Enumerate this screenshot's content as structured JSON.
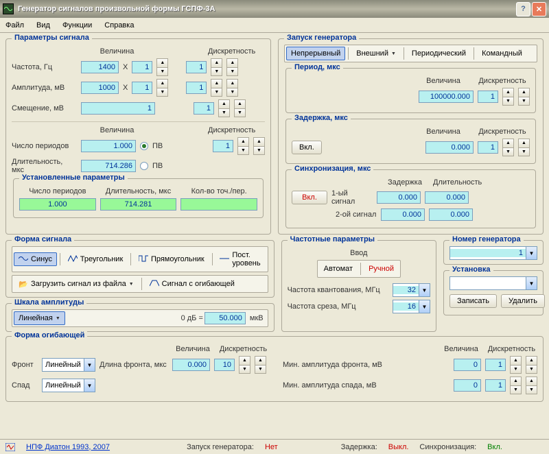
{
  "title": "Генератор сигналов произвольной формы ГСПФ-3А",
  "menu": [
    "Файл",
    "Вид",
    "Функции",
    "Справка"
  ],
  "sigparams": {
    "legend": "Параметры сигнала",
    "col_val": "Величина",
    "col_disc": "Дискретность",
    "freq_lbl": "Частота, Гц",
    "freq_val": "1400",
    "freq_mul": "1",
    "freq_disc": "1",
    "amp_lbl": "Амплитуда, мВ",
    "amp_val": "1000",
    "amp_mul": "1",
    "amp_disc": "1",
    "off_lbl": "Смещение, мВ",
    "off_val": "1",
    "off_disc": "1",
    "periods_lbl": "Число периодов",
    "periods_val": "1.000",
    "periods_disc": "1",
    "dur_lbl": "Длительность, мкс",
    "dur_val": "714.286",
    "radio_pv": "ПВ",
    "set_legend": "Установленные параметры",
    "set_periods_lbl": "Число периодов",
    "set_periods_val": "1.000",
    "set_dur_lbl": "Длительность, мкс",
    "set_dur_val": "714.281",
    "set_pts_lbl": "Кол-во точ./пер."
  },
  "gen": {
    "legend": "Запуск генератора",
    "modes": [
      "Непрерывный",
      "Внешний",
      "Периодический",
      "Командный"
    ],
    "period_legend": "Период, мкс",
    "col_val": "Величина",
    "col_disc": "Дискретность",
    "period_val": "100000.000",
    "period_disc": "1",
    "delay_legend": "Задержка, мкс",
    "delay_btn": "Вкл.",
    "delay_val": "0.000",
    "delay_disc": "1",
    "sync_legend": "Синхронизация, мкс",
    "sync_btn": "Вкл.",
    "sync_delay_lbl": "Задержка",
    "sync_dur_lbl": "Длительность",
    "sync_sig1_lbl": "1-ый сигнал",
    "sync_sig1_delay": "0.000",
    "sync_sig1_dur": "0.000",
    "sync_sig2_lbl": "2-ой сигнал",
    "sync_sig2_delay": "0.000",
    "sync_sig2_dur": "0.000"
  },
  "shape": {
    "legend": "Форма сигнала",
    "sinus": "Синус",
    "tri": "Треугольник",
    "rect": "Прямоугольник",
    "dc": "Пост. уровень",
    "load": "Загрузить сигнал  из файла",
    "envelope": "Сигнал с огибающей"
  },
  "scale": {
    "legend": "Шкала амплитуды",
    "mode": "Линейная",
    "zero_db": "0 дБ =",
    "val": "50.000",
    "unit": "мкВ"
  },
  "freqp": {
    "legend": "Частотные параметры",
    "input_lbl": "Ввод",
    "auto": "Автомат",
    "manual": "Ручной",
    "fs_lbl": "Частота квантования, МГц",
    "fs_val": "32",
    "cut_lbl": "Частота среза, МГц",
    "cut_val": "16"
  },
  "gennum": {
    "legend": "Номер генератора",
    "val": "1"
  },
  "install": {
    "legend": "Установка",
    "write": "Записать",
    "delete": "Удалить"
  },
  "env": {
    "legend": "Форма огибающей",
    "front_lbl": "Фронт",
    "front_mode": "Линейный",
    "decay_lbl": "Спад",
    "decay_mode": "Линейный",
    "dur_lbl": "Длина фронта, мкс",
    "col_val": "Величина",
    "col_disc": "Дискретность",
    "dur_val": "0.000",
    "dur_disc": "10",
    "min_front_lbl": "Мин. амплитуда фронта, мВ",
    "min_front_val": "0",
    "min_front_disc": "1",
    "min_decay_lbl": "Мин. амплитуда спада, мВ",
    "min_decay_val": "0",
    "min_decay_disc": "1"
  },
  "status": {
    "vendor": "НПФ Диатон 1993, 2007",
    "launch_lbl": "Запуск генератора:",
    "launch_val": "Нет",
    "delay_lbl": "Задержка:",
    "delay_val": "Выкл.",
    "sync_lbl": "Синхронизация:",
    "sync_val": "Вкл."
  }
}
